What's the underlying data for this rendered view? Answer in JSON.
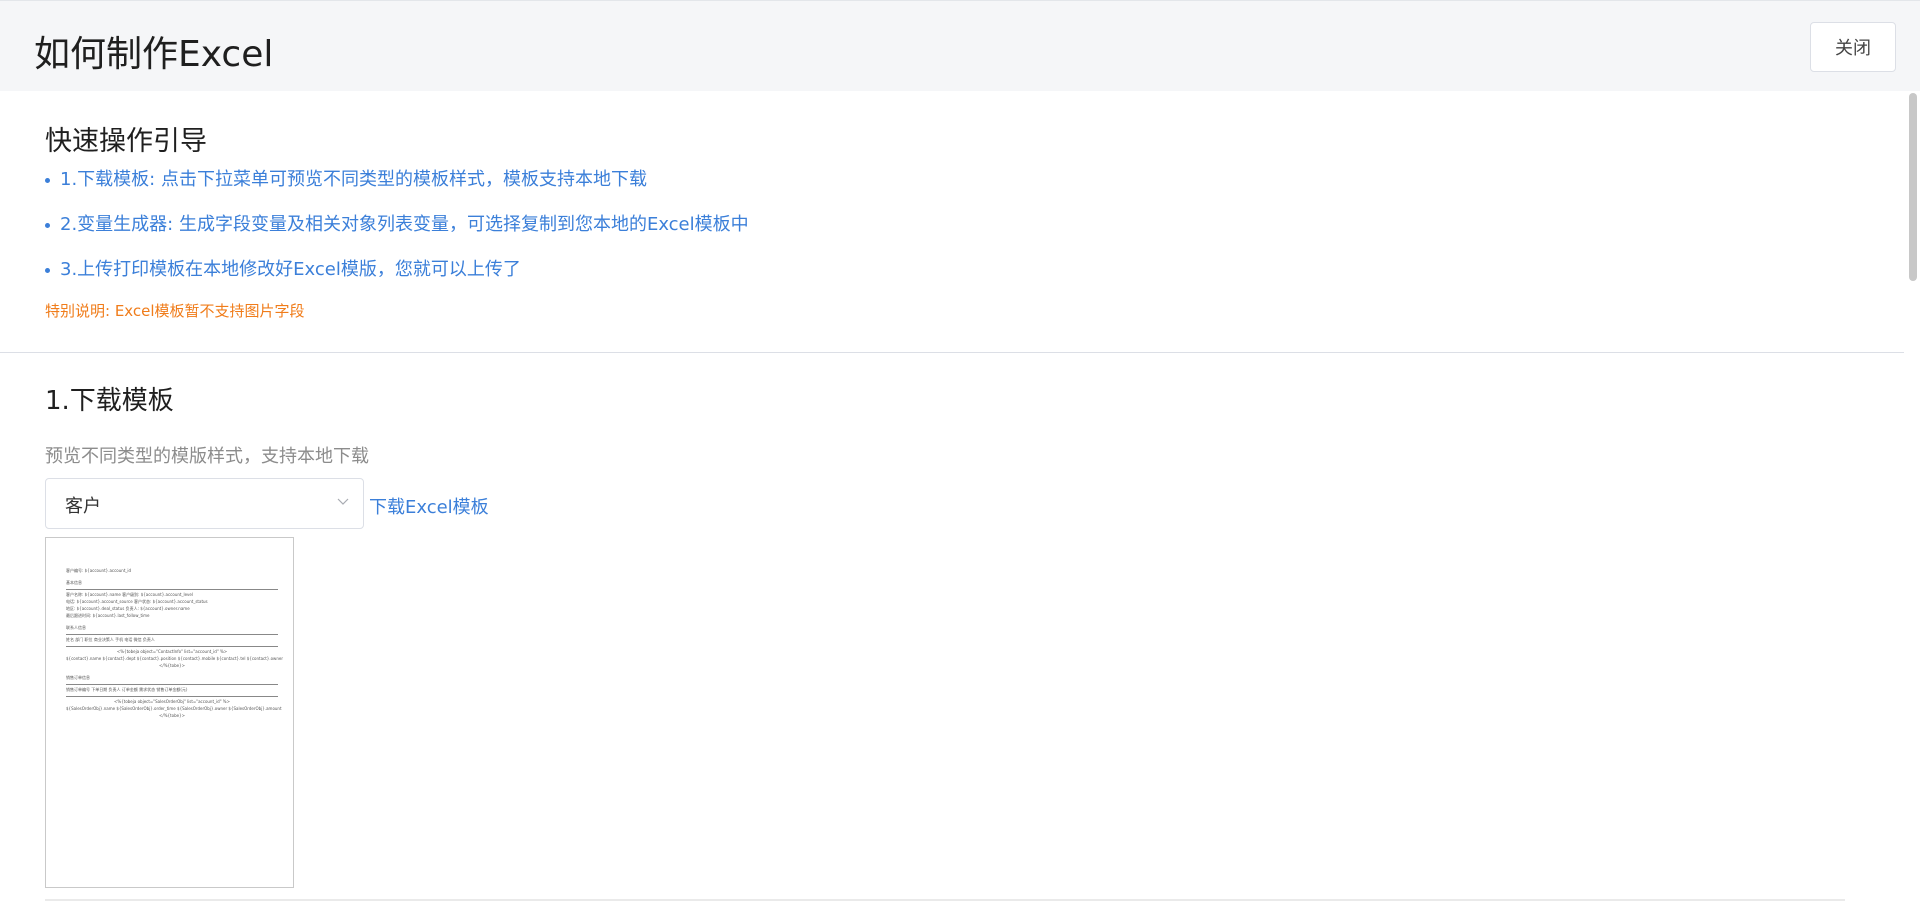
{
  "header": {
    "title": "如何制作Excel",
    "close_label": "关闭"
  },
  "guide": {
    "title": "快速操作引导",
    "steps": [
      "1.下载模板: 点击下拉菜单可预览不同类型的模板样式，模板支持本地下载",
      "2.变量生成器: 生成字段变量及相关对象列表变量，可选择复制到您本地的Excel模板中",
      "3.上传打印模板在本地修改好Excel模版，您就可以上传了"
    ],
    "note": "特别说明: Excel模板暂不支持图片字段"
  },
  "download_section": {
    "title": "1.下载模板",
    "description": "预览不同类型的模版样式，支持本地下载",
    "select_value": "客户",
    "download_link": "下载Excel模板"
  },
  "preview": {
    "lines": [
      "客户编号:    ${account}.account_id",
      "基本信息",
      "客户名称:    ${account}.name       客户级别:  ${account}.account_level",
      "电话:       ${account}.account_source  客户状态:  ${account}.account_status",
      "地区:       ${account}.deal_status    负责人:    ${account}.owner.name",
      "最后跟进时间: ${account}.last_follow_time",
      "联系人信息",
      "姓名     部门     职位     商业决策人    手机     电话     微信     负责人",
      "<%{tobeja object=\"ContactInfo\"  list=\"account_id\" %>",
      "${contact}.name ${contact}.dept ${contact}.position ${contact}.mobile ${contact}.tel ${contact}.owner",
      "</%{tobe}>",
      "销售订单信息",
      "销售订单编号    下单日期    负责人    订单金额    需求状态    销售订单金额(元)",
      "<%{tobeja object=\"SalesOrderObj\"  list=\"account_id\" %>",
      "${SalesOrderObj}.name ${SalesOrderObj}.order_time ${SalesOrderObj}.owner ${SalesOrderObj}.amount",
      "</%{tobe}>"
    ]
  }
}
